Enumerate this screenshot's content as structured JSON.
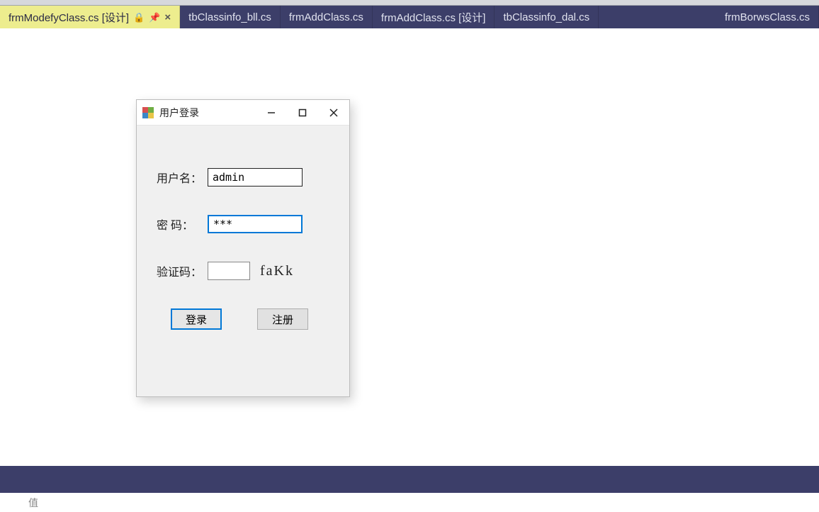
{
  "tabs": [
    {
      "label": "frmModefyClass.cs [设计]",
      "active": true
    },
    {
      "label": "tbClassinfo_bll.cs",
      "active": false
    },
    {
      "label": "frmAddClass.cs",
      "active": false
    },
    {
      "label": "frmAddClass.cs [设计]",
      "active": false
    },
    {
      "label": "tbClassinfo_dal.cs",
      "active": false
    },
    {
      "label": "frmBorwsClass.cs",
      "active": false
    }
  ],
  "login_window": {
    "title": "用户登录",
    "username_label": "用户名：",
    "username_value": "admin",
    "password_label": "密 码：",
    "password_value": "***",
    "captcha_label": "验证码：",
    "captcha_value": "",
    "captcha_text": "faKk",
    "login_button": "登录",
    "register_button": "注册"
  },
  "footer": {
    "value_label": "值"
  }
}
